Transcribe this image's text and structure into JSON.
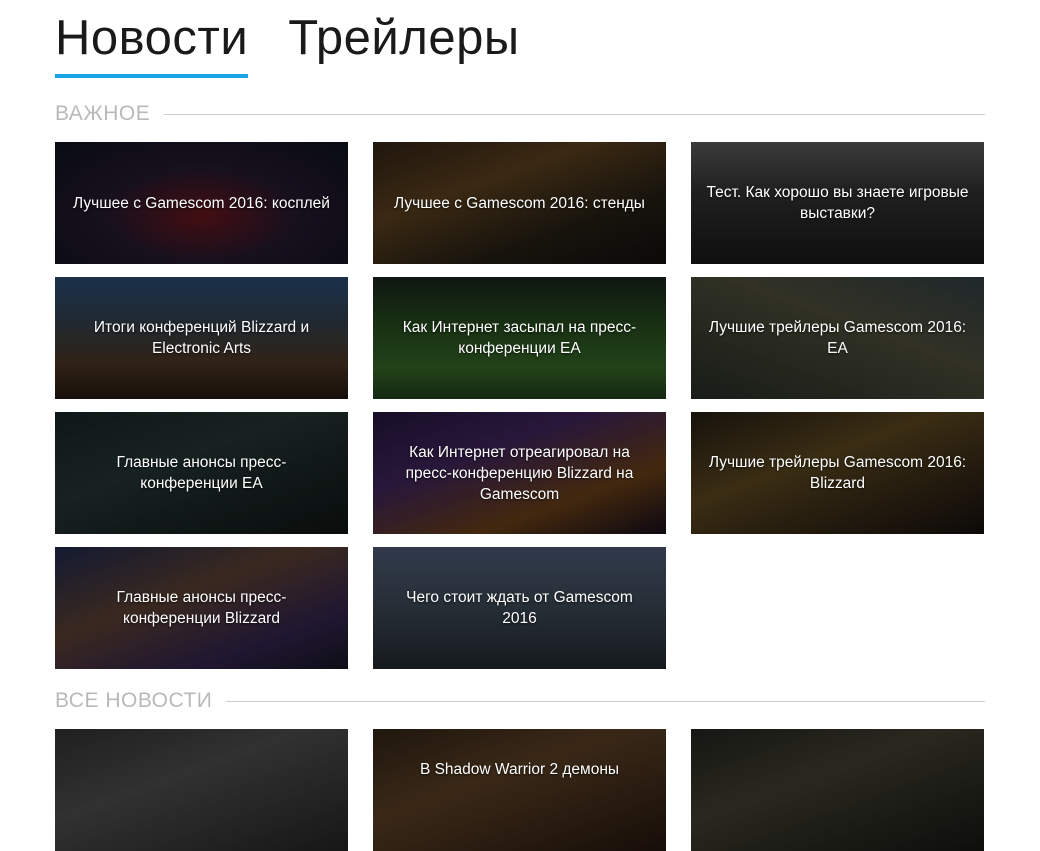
{
  "tabs": [
    {
      "label": "Новости"
    },
    {
      "label": "Трейлеры"
    }
  ],
  "accent_color": "#1aa3e6",
  "sections": {
    "important": "ВАЖНОЕ",
    "all_news": "ВСЕ НОВОСТИ"
  },
  "important_cards": [
    {
      "title": "Лучшее с Gamescom 2016: косплей"
    },
    {
      "title": "Лучшее с Gamescom 2016: стенды"
    },
    {
      "title": "Тест. Как хорошо вы знаете игровые выставки?"
    },
    {
      "title": "Итоги конференций Blizzard и Electronic Arts"
    },
    {
      "title": "Как Интернет засыпал на пресс-конференции EA"
    },
    {
      "title": "Лучшие трейлеры Gamescom 2016: EA"
    },
    {
      "title": "Главные анонсы пресс-конференции EA"
    },
    {
      "title": "Как Интернет отреагировал на пресс-конференцию Blizzard на Gamescom"
    },
    {
      "title": "Лучшие трейлеры Gamescom 2016: Blizzard"
    },
    {
      "title": "Главные анонсы пресс-конференции Blizzard"
    },
    {
      "title": "Чего стоит ждать от Gamescom 2016"
    }
  ],
  "all_news_cards": [
    {
      "title": ""
    },
    {
      "title": "В Shadow Warrior 2 демоны"
    },
    {
      "title": ""
    }
  ]
}
